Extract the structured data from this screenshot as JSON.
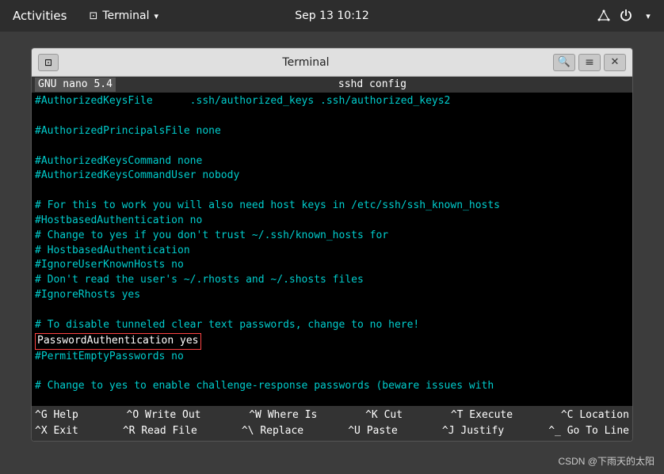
{
  "topbar": {
    "activities_label": "Activities",
    "terminal_label": "Terminal",
    "datetime": "Sep 13  10:12"
  },
  "window": {
    "title": "Terminal",
    "restore_icon": "⊡",
    "search_icon": "🔍",
    "menu_icon": "≡",
    "close_icon": "✕"
  },
  "nano": {
    "header_left": "GNU nano 5.4",
    "header_center": "sshd config",
    "lines": [
      {
        "text": "#AuthorizedKeysFile      .ssh/authorized_keys .ssh/authorized_keys2",
        "color": "cyan"
      },
      {
        "text": "",
        "color": ""
      },
      {
        "text": "#AuthorizedPrincipalsFile none",
        "color": "cyan"
      },
      {
        "text": "",
        "color": ""
      },
      {
        "text": "#AuthorizedKeysCommand none",
        "color": "cyan"
      },
      {
        "text": "#AuthorizedKeysCommandUser nobody",
        "color": "cyan"
      },
      {
        "text": "",
        "color": ""
      },
      {
        "text": "# For this to work you will also need host keys in /etc/ssh/ssh_known_hosts",
        "color": "cyan"
      },
      {
        "text": "#HostbasedAuthentication no",
        "color": "cyan"
      },
      {
        "text": "# Change to yes if you don't trust ~/.ssh/known_hosts for",
        "color": "cyan"
      },
      {
        "text": "# HostbasedAuthentication",
        "color": "cyan"
      },
      {
        "text": "#IgnoreUserKnownHosts no",
        "color": "cyan"
      },
      {
        "text": "# Don't read the user's ~/.rhosts and ~/.shosts files",
        "color": "cyan"
      },
      {
        "text": "#IgnoreRhosts yes",
        "color": "cyan"
      },
      {
        "text": "",
        "color": ""
      },
      {
        "text": "# To disable tunneled clear text passwords, change to no here!",
        "color": "cyan"
      },
      {
        "text": "PasswordAuthentication yes",
        "color": "highlighted"
      },
      {
        "text": "#PermitEmptyPasswords no",
        "color": "cyan"
      },
      {
        "text": "",
        "color": ""
      },
      {
        "text": "# Change to yes to enable challenge-response passwords (beware issues with",
        "color": "cyan"
      }
    ],
    "footer": {
      "row1": [
        {
          "key": "^G",
          "label": "Help"
        },
        {
          "key": "^O",
          "label": "Write Out"
        },
        {
          "key": "^W",
          "label": "Where Is"
        },
        {
          "key": "^K",
          "label": "Cut"
        },
        {
          "key": "^T",
          "label": "Execute"
        },
        {
          "key": "^C",
          "label": "Location"
        }
      ],
      "row2": [
        {
          "key": "^X",
          "label": "Exit"
        },
        {
          "key": "^R",
          "label": "Read File"
        },
        {
          "key": "^\\",
          "label": "Replace"
        },
        {
          "key": "^U",
          "label": "Paste"
        },
        {
          "key": "^J",
          "label": "Justify"
        },
        {
          "key": "^_",
          "label": "Go To Line"
        }
      ]
    }
  },
  "watermark": "CSDN @下雨天的太阳"
}
